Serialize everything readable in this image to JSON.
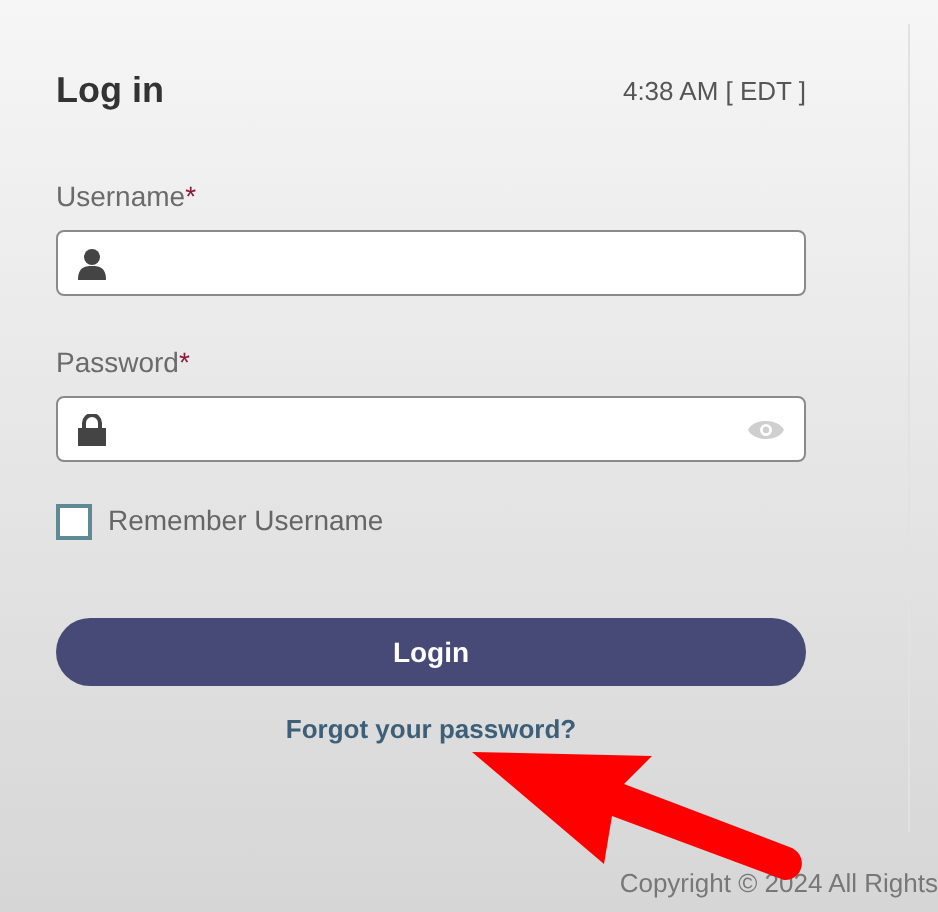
{
  "header": {
    "title": "Log in",
    "time": "4:38 AM [ EDT ]"
  },
  "fields": [
    {
      "kind": "username",
      "label": "Username",
      "required_mark": "*"
    },
    {
      "kind": "password",
      "label": "Password",
      "required_mark": "*"
    }
  ],
  "remember": {
    "label": "Remember Username",
    "checked": false
  },
  "login_button": "Login",
  "forgot_link": "Forgot your password?",
  "footer": {
    "copyright": "Copyright © 2024 All Rights"
  }
}
